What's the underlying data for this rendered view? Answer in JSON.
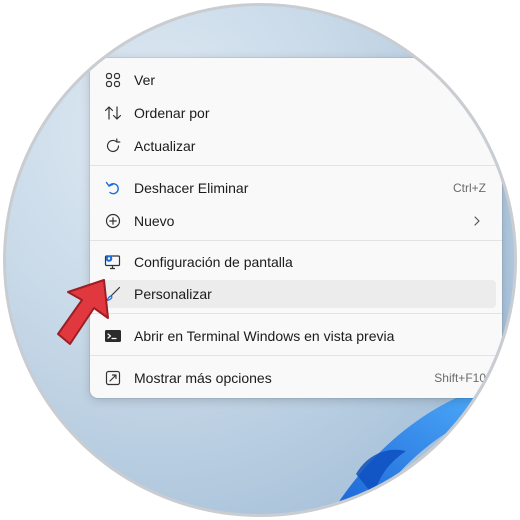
{
  "menu": {
    "items": [
      {
        "label": "Ver",
        "icon": "view-grid-icon"
      },
      {
        "label": "Ordenar por",
        "icon": "sort-icon"
      },
      {
        "label": "Actualizar",
        "icon": "refresh-icon"
      },
      {
        "label": "Deshacer Eliminar",
        "icon": "undo-icon",
        "shortcut": "Ctrl+Z"
      },
      {
        "label": "Nuevo",
        "icon": "new-plus-icon",
        "submenu": true
      },
      {
        "label": "Configuración de pantalla",
        "icon": "display-settings-icon"
      },
      {
        "label": "Personalizar",
        "icon": "paintbrush-icon",
        "highlighted": true
      },
      {
        "label": "Abrir en Terminal Windows en vista previa",
        "icon": "terminal-icon"
      },
      {
        "label": "Mostrar más opciones",
        "icon": "more-options-icon",
        "shortcut": "Shift+F10"
      }
    ]
  },
  "colors": {
    "accent": "#1a6fd8",
    "arrow": "#e0383e",
    "menu_bg": "#f9f9f9"
  }
}
